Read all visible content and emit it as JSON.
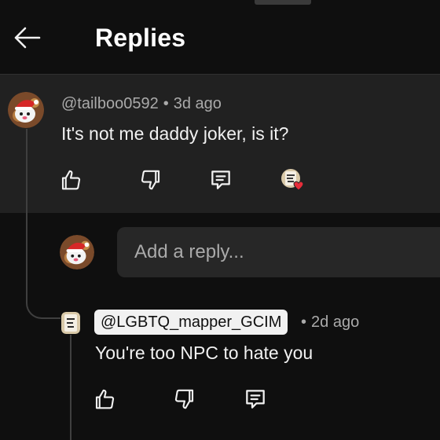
{
  "header": {
    "title": "Replies"
  },
  "parent": {
    "handle": "@tailboo0592",
    "separator": "•",
    "age": "3d ago",
    "text": "It's not me daddy joker, is it?"
  },
  "reply_box": {
    "placeholder": "Add a reply..."
  },
  "reply": {
    "handle": "@LGBTQ_mapper_GCIM",
    "separator": "•",
    "age": "2d ago",
    "text": "You're too NPC to hate you"
  },
  "colors": {
    "background": "#0f0f0f",
    "highlight": "#212121",
    "heart": "#e62d3a"
  },
  "icons": [
    "back-arrow-icon",
    "like-icon",
    "dislike-icon",
    "reply-icon",
    "creator-heart-icon"
  ]
}
